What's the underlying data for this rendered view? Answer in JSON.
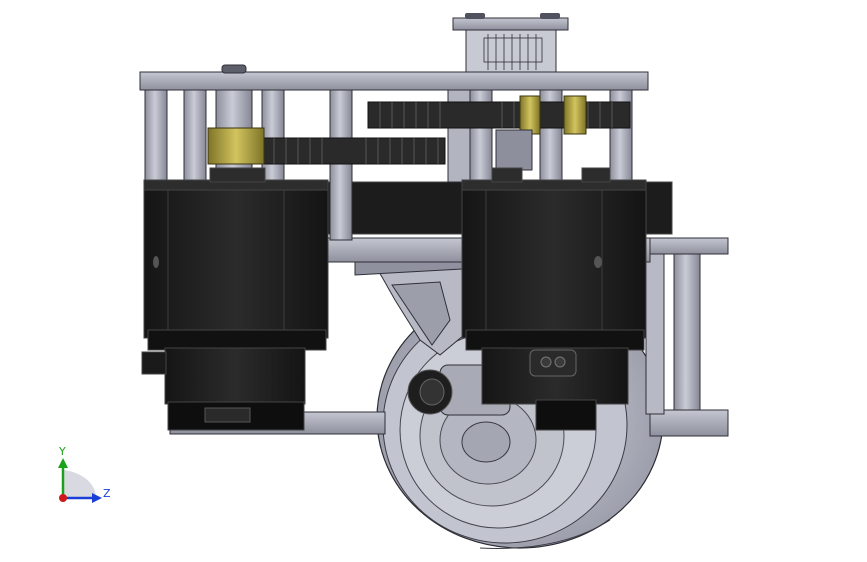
{
  "viewport": {
    "background": "#ffffff",
    "model_colors": {
      "metal": "#a9abb8",
      "metal_dark": "#6f7180",
      "motor": "#1f1f1f",
      "motor_edge": "#3a3a3a",
      "brass": "#b5a84a",
      "wheel": "#b9bbc7"
    }
  },
  "triad": {
    "y_label": "Y",
    "z_label": "Z",
    "y_color": "#1aa31a",
    "z_color": "#1a3fd6",
    "origin_color": "#d01818"
  }
}
